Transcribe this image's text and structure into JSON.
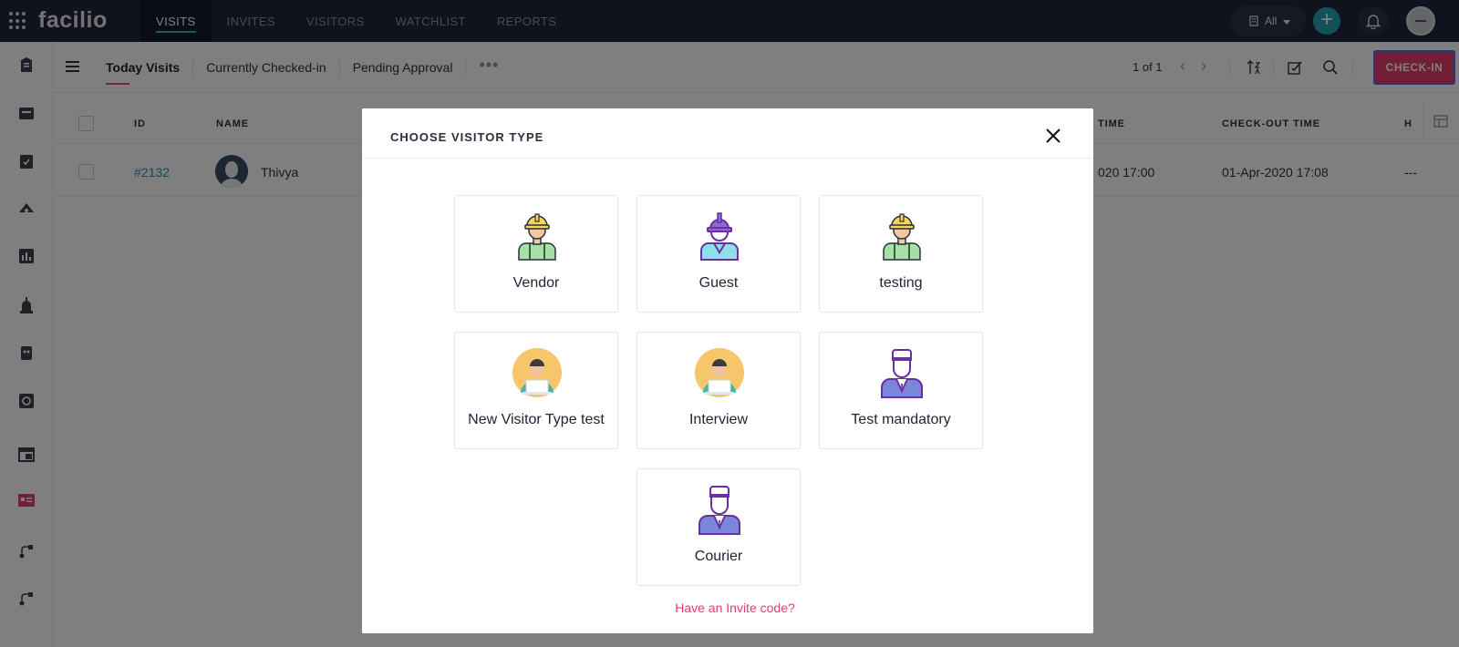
{
  "app": {
    "logo": "facilio",
    "nav": [
      "VISITS",
      "INVITES",
      "VISITORS",
      "WATCHLIST",
      "REPORTS"
    ],
    "active_nav": "VISITS",
    "site_filter": "All",
    "accent_color": "#25a3b3",
    "brand_pink": "#e23c6f"
  },
  "subheader": {
    "views": [
      "Today Visits",
      "Currently Checked-in",
      "Pending Approval"
    ],
    "more": "•••",
    "pagination": "1 of 1",
    "checkin_label": "CHECK-IN"
  },
  "table": {
    "columns": {
      "id": "ID",
      "name": "NAME",
      "checkin": "TIME",
      "checkout": "CHECK-OUT TIME",
      "extra": "H"
    },
    "rows": [
      {
        "id": "#2132",
        "name": "Thivya",
        "checkin": "020 17:00",
        "checkout": "01-Apr-2020 17:08",
        "extra": "---"
      }
    ]
  },
  "dialog": {
    "title": "CHOOSE VISITOR TYPE",
    "visitor_types": [
      {
        "label": "Vendor",
        "icon": "worker-icon"
      },
      {
        "label": "Guest",
        "icon": "guest-icon"
      },
      {
        "label": "testing",
        "icon": "worker-icon"
      },
      {
        "label": "New Visitor Type test",
        "icon": "laptop-user-icon"
      },
      {
        "label": "Interview",
        "icon": "laptop-user-icon"
      },
      {
        "label": "Test mandatory",
        "icon": "uniform-person-icon"
      },
      {
        "label": "Courier",
        "icon": "uniform-person-icon"
      }
    ],
    "invite_link": "Have an Invite code?"
  }
}
